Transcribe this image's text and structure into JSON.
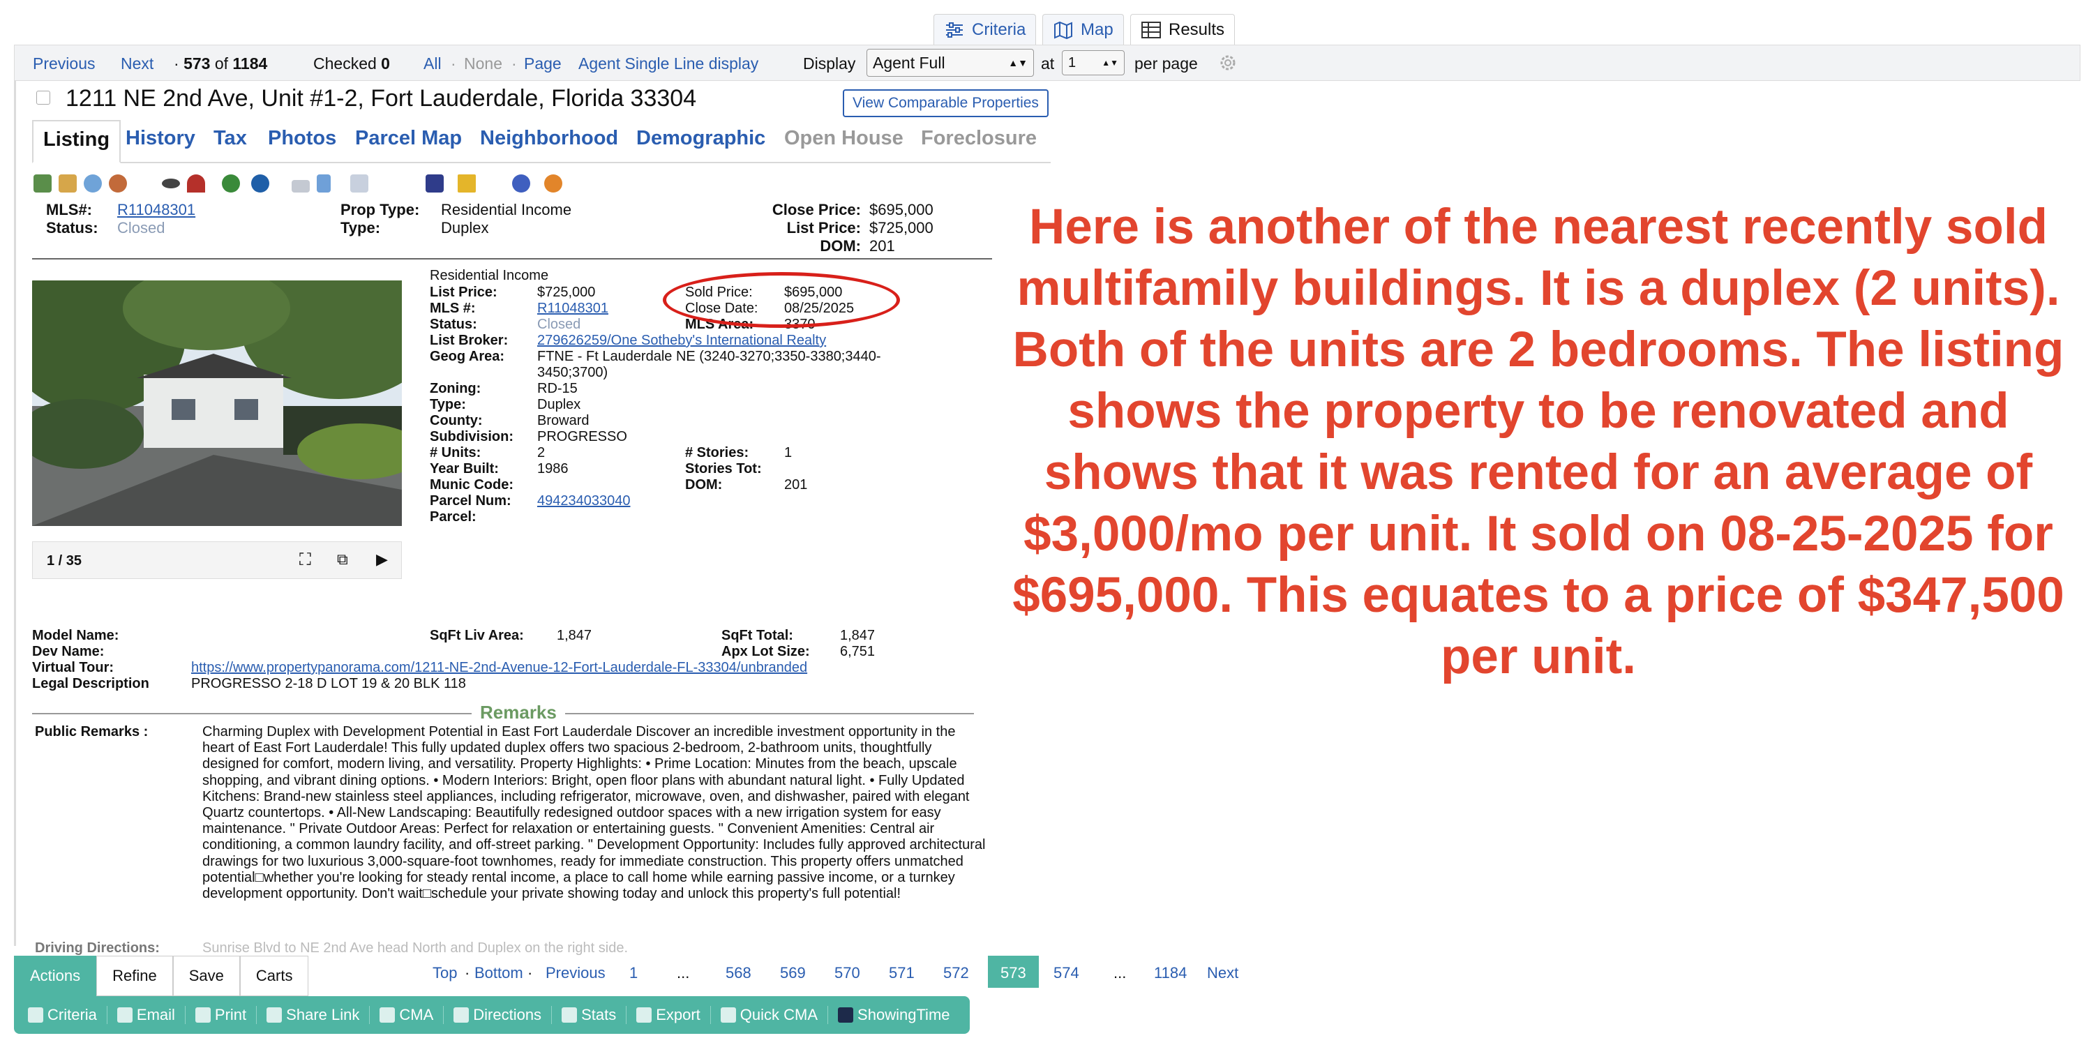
{
  "top_tabs": [
    {
      "label": "Criteria",
      "icon": "sliders-icon"
    },
    {
      "label": "Map",
      "icon": "map-icon"
    },
    {
      "label": "Results",
      "icon": "grid-icon",
      "active": true
    }
  ],
  "navbar": {
    "previous": "Previous",
    "next": "Next",
    "position_prefix": "·",
    "position_current": "573",
    "position_of": "of",
    "position_total": "1184",
    "checked_label": "Checked",
    "checked_count": "0",
    "all": "All",
    "none": "None",
    "page": "Page",
    "sep": "·",
    "agent_single_line": "Agent Single Line display",
    "display_label": "Display",
    "display_value": "Agent Full",
    "at_label": "at",
    "per_page_value": "1",
    "per_page_label": "per page"
  },
  "listing": {
    "address": "1211 NE 2nd Ave, Unit #1-2, Fort Lauderdale, Florida 33304",
    "comparable_button": "View Comparable Properties",
    "tabs": [
      {
        "label": "Listing",
        "active": true
      },
      {
        "label": "History"
      },
      {
        "label": "Tax"
      },
      {
        "label": "Photos"
      },
      {
        "label": "Parcel Map"
      },
      {
        "label": "Neighborhood"
      },
      {
        "label": "Demographic"
      },
      {
        "label": "Open House",
        "disabled": true
      },
      {
        "label": "Foreclosure",
        "disabled": true
      }
    ],
    "summary": {
      "mls_label": "MLS#:",
      "mls_value": "R11048301",
      "status_label": "Status:",
      "status_value": "Closed",
      "prop_type_label": "Prop Type:",
      "prop_type_value": "Residential Income",
      "type_label": "Type:",
      "type_value": "Duplex",
      "close_price_label": "Close Price:",
      "close_price_value": "$695,000",
      "list_price_label": "List Price:",
      "list_price_value": "$725,000",
      "dom_label": "DOM:",
      "dom_value": "201"
    },
    "photo_counter": "1 / 35",
    "details": {
      "heading": "Residential Income",
      "list_price_label": "List Price:",
      "list_price": "$725,000",
      "mls_label": "MLS #:",
      "mls": "R11048301",
      "status_label": "Status:",
      "status": "Closed",
      "broker_label": "List Broker:",
      "broker": "279626259/One Sotheby's International Realty",
      "geog_label": "Geog Area:",
      "geog_line1": "FTNE - Ft Lauderdale NE (3240-3270;3350-3380;3440-",
      "geog_line2": "3450;3700)",
      "zoning_label": "Zoning:",
      "zoning": "RD-15",
      "type_label": "Type:",
      "type": "Duplex",
      "county_label": "County:",
      "county": "Broward",
      "subdivision_label": "Subdivision:",
      "subdivision": "PROGRESSO",
      "units_label": "# Units:",
      "units": "2",
      "year_label": "Year Built:",
      "year": "1986",
      "munic_label": "Munic Code:",
      "parcel_num_label": "Parcel Num:",
      "parcel_num": "494234033040",
      "parcel_label": "Parcel:",
      "sold_price_label": "Sold Price:",
      "sold_price": "$695,000",
      "close_date_label": "Close Date:",
      "close_date": "08/25/2025",
      "mls_area_label": "MLS Area:",
      "mls_area": "3370",
      "stories_label": "# Stories:",
      "stories": "1",
      "stories_tot_label": "Stories Tot:",
      "dom_label": "DOM:",
      "dom": "201"
    },
    "extra": {
      "model_label": "Model Name:",
      "dev_label": "Dev Name:",
      "tour_label": "Virtual Tour:",
      "tour_url": "https://www.propertypanorama.com/1211-NE-2nd-Avenue-12-Fort-Lauderdale-FL-33304/unbranded",
      "legal_label": "Legal Description",
      "legal_value": "PROGRESSO 2-18 D LOT 19 & 20 BLK 118",
      "sqft_liv_label": "SqFt Liv Area:",
      "sqft_liv": "1,847",
      "sqft_total_label": "SqFt Total:",
      "sqft_total": "1,847",
      "lot_label": "Apx Lot Size:",
      "lot": "6,751"
    },
    "remarks_title": "Remarks",
    "public_remarks_label": "Public Remarks :",
    "public_remarks": "Charming Duplex with Development Potential in East Fort Lauderdale Discover an incredible investment opportunity in the heart of East Fort Lauderdale! This fully updated duplex offers two spacious 2-bedroom, 2-bathroom units, thoughtfully designed for comfort, modern living, and versatility. Property Highlights: • Prime Location: Minutes from the beach, upscale shopping, and vibrant dining options. • Modern Interiors: Bright, open floor plans with abundant natural light. • Fully Updated Kitchens: Brand-new stainless steel appliances, including refrigerator, microwave, oven, and dishwasher, paired with elegant Quartz countertops. • All-New Landscaping: Beautifully redesigned outdoor spaces with a new irrigation system for easy maintenance. \" Private Outdoor Areas: Perfect for relaxation or entertaining guests. \" Convenient Amenities: Central air conditioning, a common laundry facility, and off-street parking. \" Development Opportunity: Includes fully approved architectural drawings for two luxurious 3,000-square-foot townhomes, ready for immediate construction. This property offers unmatched potential□whether you're looking for steady rental income, a place to call home while earning passive income, or a turnkey development opportunity. Don't wait□schedule your private showing today and unlock this property's full potential!",
    "driving_label": "Driving Directions:",
    "driving_value": "Sunrise Blvd to NE 2nd Ave head North and Duplex on the right side."
  },
  "annotation": "Here is another of the nearest recently sold multifamily buildings. It is a duplex (2 units). Both of the units are 2 bedrooms. The listing shows the property to be renovated and shows that it was rented for an average of $3,000/mo per unit. It sold on 08-25-2025 for $695,000. This equates to a price of $347,500 per unit.",
  "bottom": {
    "tabs": [
      {
        "label": "Actions",
        "active": true
      },
      {
        "label": "Refine"
      },
      {
        "label": "Save"
      },
      {
        "label": "Carts"
      }
    ],
    "actions": [
      {
        "label": "Criteria",
        "icon": "search-icon"
      },
      {
        "label": "Email",
        "icon": "email-icon"
      },
      {
        "label": "Print",
        "icon": "print-icon"
      },
      {
        "label": "Share Link",
        "icon": "link-icon"
      },
      {
        "label": "CMA",
        "icon": "document-icon"
      },
      {
        "label": "Directions",
        "icon": "compass-icon"
      },
      {
        "label": "Stats",
        "icon": "bar-chart-icon"
      },
      {
        "label": "Export",
        "icon": "export-icon"
      },
      {
        "label": "Quick CMA",
        "icon": "document-icon"
      },
      {
        "label": "ShowingTime",
        "icon": "showingtime-icon"
      }
    ],
    "pager": {
      "top": "Top",
      "bottom": "Bottom",
      "dot": "·",
      "previous": "Previous",
      "pages": [
        "1",
        "...",
        "568",
        "569",
        "570",
        "571",
        "572",
        "573",
        "574",
        "...",
        "1184"
      ],
      "current": "573",
      "next": "Next"
    }
  },
  "colors": {
    "link": "#2a5db0",
    "accent_teal": "#4fb5a3",
    "annotation_red": "#e2452e",
    "remarks_green": "#6b9a62"
  }
}
